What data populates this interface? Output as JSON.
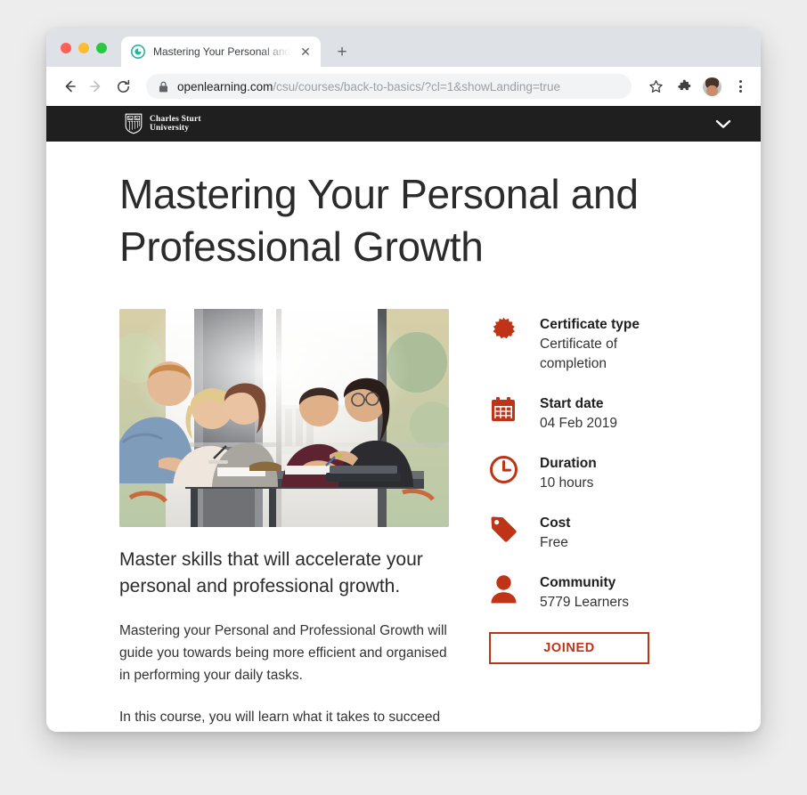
{
  "browser": {
    "tab": {
      "title": "Mastering Your Personal and P",
      "favicon_name": "openlearning-logo-icon",
      "close_label": "✕"
    },
    "new_tab_label": "+",
    "nav": {
      "back_label": "←",
      "forward_label": "→",
      "reload_label": "↻"
    },
    "omnibox": {
      "lock_name": "padlock-icon",
      "url_domain": "openlearning.com",
      "url_path": "/csu/courses/back-to-basics/?cl=1&showLanding=true"
    },
    "toolbar_icons": [
      "bookmark-star-icon",
      "extensions-puzzle-icon",
      "profile-avatar",
      "kebab-menu-icon"
    ]
  },
  "site": {
    "brand_line1": "Charles Sturt",
    "brand_line2": "University",
    "menu_chevron_name": "chevron-down-icon"
  },
  "course": {
    "title": "Mastering Your Personal and Professional Growth",
    "hero_alt": "Five students studying together at a table by a window",
    "lead": "Master skills that will accelerate your personal and professional growth.",
    "paragraph1": "Mastering your Personal and Professional Growth will guide you towards being more efficient and organised in performing your daily tasks.",
    "paragraph2": "In this course, you will learn what it takes to succeed",
    "cta_label": "JOINED",
    "details": [
      {
        "icon": "certificate-badge-icon",
        "label": "Certificate type",
        "value": "Certificate of completion"
      },
      {
        "icon": "calendar-icon",
        "label": "Start date",
        "value": "04 Feb 2019"
      },
      {
        "icon": "clock-icon",
        "label": "Duration",
        "value": "10 hours"
      },
      {
        "icon": "price-tag-icon",
        "label": "Cost",
        "value": "Free"
      },
      {
        "icon": "person-icon",
        "label": "Community",
        "value": "5779 Learners"
      }
    ]
  },
  "colors": {
    "accent_red": "#bf3317",
    "header_dark": "#1f1f1f",
    "tabstrip": "#dee1e6",
    "page_bg": "#ededed",
    "favicon_teal": "#2ab0a6"
  }
}
